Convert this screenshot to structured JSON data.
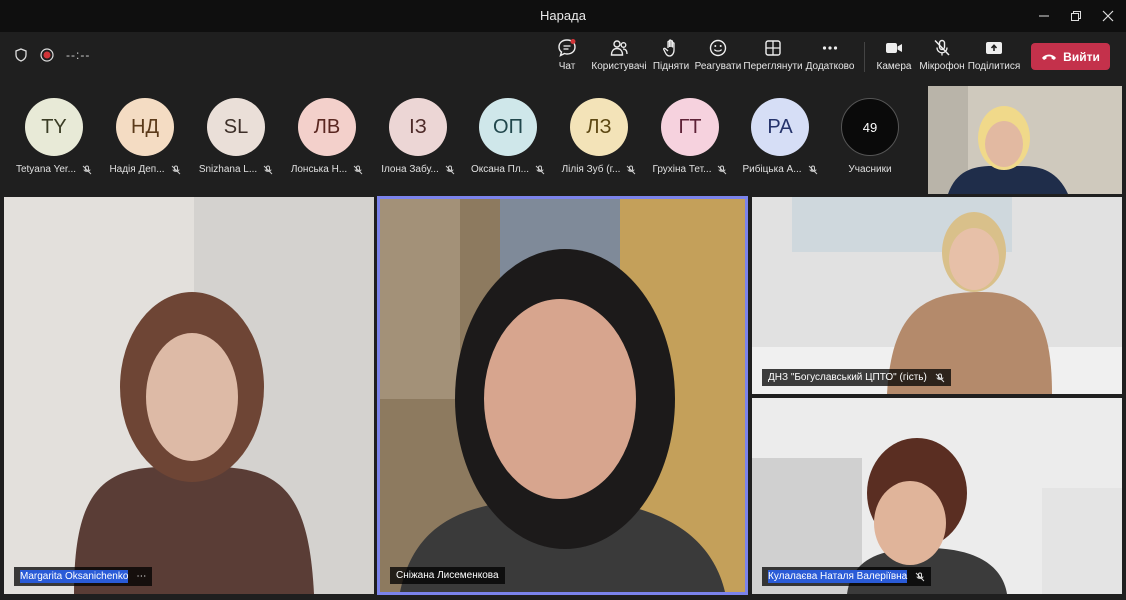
{
  "window": {
    "title": "Нарада"
  },
  "meeting": {
    "timer": "--:--"
  },
  "toolbar": {
    "chat": "Чат",
    "people": "Користувачі",
    "raise": "Підняти",
    "react": "Реагувати",
    "view": "Переглянути",
    "more": "Додатково",
    "camera": "Камера",
    "mic": "Мікрофон",
    "share": "Поділитися",
    "leave": "Вийти"
  },
  "participants": [
    {
      "initials": "TY",
      "name": "Tetyana Yer...",
      "bg": "#e8ead7",
      "fg": "#3b3d26"
    },
    {
      "initials": "НД",
      "name": "Надія Деп...",
      "bg": "#f4dcc3",
      "fg": "#5b3a1a"
    },
    {
      "initials": "SL",
      "name": "Snizhana L...",
      "bg": "#eadfd8",
      "fg": "#3d2f28"
    },
    {
      "initials": "ЛВ",
      "name": "Лонська Н...",
      "bg": "#f3d0cb",
      "fg": "#5a2721"
    },
    {
      "initials": "ІЗ",
      "name": "Ілона Забу...",
      "bg": "#ecd6d5",
      "fg": "#4d2a28"
    },
    {
      "initials": "ОП",
      "name": "Оксана Пл...",
      "bg": "#cfe7ea",
      "fg": "#21474c"
    },
    {
      "initials": "ЛЗ",
      "name": "Лілія Зуб (г...",
      "bg": "#f3e3b8",
      "fg": "#5c4712"
    },
    {
      "initials": "ГТ",
      "name": "Грухіна Тет...",
      "bg": "#f6d2de",
      "fg": "#5e2237"
    },
    {
      "initials": "РА",
      "name": "Рибіцька А...",
      "bg": "#d6def6",
      "fg": "#25336b"
    }
  ],
  "overflow": {
    "count": "49",
    "label": "Учасники"
  },
  "tiles": {
    "t1": {
      "name": "Margarita Oksanichenko"
    },
    "t2": {
      "name": "Сніжана Лисеменкова"
    },
    "t3": {
      "name": "ДНЗ \"Богуславський ЦПТО\" (гість)"
    },
    "t4": {
      "name": "Кулалаєва Наталя Валеріївна"
    }
  },
  "colors": {
    "accent": "#7b83eb",
    "leave": "#c4314b",
    "recording": "#d13438"
  }
}
